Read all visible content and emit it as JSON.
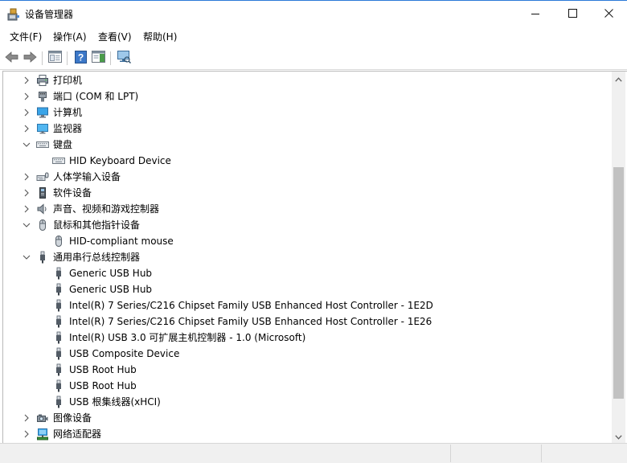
{
  "window": {
    "title": "设备管理器",
    "title_icon": "device-manager-icon",
    "controls": [
      "minimize-icon",
      "maximize-icon",
      "close-icon"
    ]
  },
  "menu": {
    "file": "文件(F)",
    "action": "操作(A)",
    "view": "查看(V)",
    "help": "帮助(H)"
  },
  "toolbar": {
    "icons": [
      "back-arrow-icon",
      "forward-arrow-icon",
      "properties-icon",
      "help-icon",
      "action-pane-icon",
      "monitor-scan-icon"
    ]
  },
  "tree": {
    "rows": [
      {
        "level": 0,
        "expander": "collapsed",
        "icon": "printer-icon",
        "label": "打印机"
      },
      {
        "level": 0,
        "expander": "collapsed",
        "icon": "port-icon",
        "label": "端口 (COM 和 LPT)"
      },
      {
        "level": 0,
        "expander": "collapsed",
        "icon": "computer-icon",
        "label": "计算机"
      },
      {
        "level": 0,
        "expander": "collapsed",
        "icon": "monitor-icon",
        "label": "监视器"
      },
      {
        "level": 0,
        "expander": "expanded",
        "icon": "keyboard-icon",
        "label": "键盘"
      },
      {
        "level": 1,
        "expander": "none",
        "icon": "keyboard-icon",
        "label": "HID Keyboard Device"
      },
      {
        "level": 0,
        "expander": "collapsed",
        "icon": "human-interface-icon",
        "label": "人体学输入设备"
      },
      {
        "level": 0,
        "expander": "collapsed",
        "icon": "software-device-icon",
        "label": "软件设备"
      },
      {
        "level": 0,
        "expander": "collapsed",
        "icon": "speaker-icon",
        "label": "声音、视频和游戏控制器"
      },
      {
        "level": 0,
        "expander": "expanded",
        "icon": "mouse-icon",
        "label": "鼠标和其他指针设备"
      },
      {
        "level": 1,
        "expander": "none",
        "icon": "mouse-icon",
        "label": "HID-compliant mouse"
      },
      {
        "level": 0,
        "expander": "expanded",
        "icon": "usb-icon",
        "label": "通用串行总线控制器"
      },
      {
        "level": 1,
        "expander": "none",
        "icon": "usb-icon",
        "label": "Generic USB Hub"
      },
      {
        "level": 1,
        "expander": "none",
        "icon": "usb-icon",
        "label": "Generic USB Hub"
      },
      {
        "level": 1,
        "expander": "none",
        "icon": "usb-icon",
        "label": "Intel(R) 7 Series/C216 Chipset Family USB Enhanced Host Controller - 1E2D"
      },
      {
        "level": 1,
        "expander": "none",
        "icon": "usb-icon",
        "label": "Intel(R) 7 Series/C216 Chipset Family USB Enhanced Host Controller - 1E26"
      },
      {
        "level": 1,
        "expander": "none",
        "icon": "usb-icon",
        "label": "Intel(R) USB 3.0 可扩展主机控制器 - 1.0 (Microsoft)"
      },
      {
        "level": 1,
        "expander": "none",
        "icon": "usb-icon",
        "label": "USB Composite Device"
      },
      {
        "level": 1,
        "expander": "none",
        "icon": "usb-icon",
        "label": "USB Root Hub"
      },
      {
        "level": 1,
        "expander": "none",
        "icon": "usb-icon",
        "label": "USB Root Hub"
      },
      {
        "level": 1,
        "expander": "none",
        "icon": "usb-icon",
        "label": "USB 根集线器(xHCI)"
      },
      {
        "level": 0,
        "expander": "collapsed",
        "icon": "camera-icon",
        "label": "图像设备"
      },
      {
        "level": 0,
        "expander": "collapsed",
        "icon": "network-adapter-icon",
        "label": "网络适配器"
      }
    ]
  },
  "colors": {
    "title_accent": "#2b79d8",
    "toolbar_blue": "#3c78c8",
    "scroll_thumb": "#c1c1c1"
  }
}
